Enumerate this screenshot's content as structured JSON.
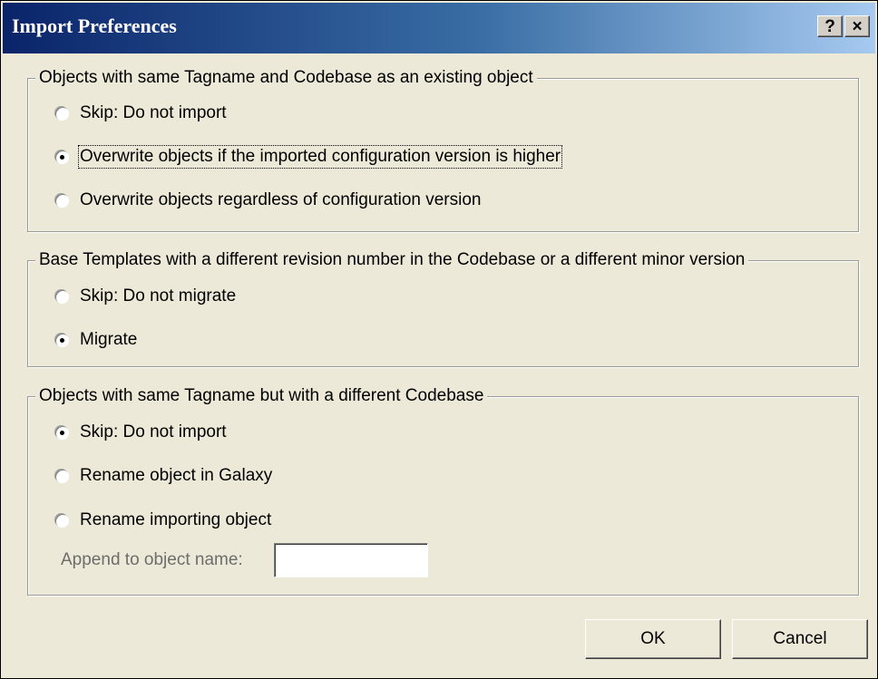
{
  "window": {
    "title": "Import Preferences",
    "help_label": "?",
    "close_label": "×"
  },
  "groups": [
    {
      "legend": "Objects with same Tagname and Codebase as an existing object",
      "options": [
        {
          "label": "Skip: Do not import",
          "selected": false
        },
        {
          "label": "Overwrite objects if the imported configuration version is higher",
          "selected": true
        },
        {
          "label": "Overwrite objects regardless of configuration version",
          "selected": false
        }
      ]
    },
    {
      "legend": "Base Templates with a different revision number in the Codebase or a different minor version",
      "options": [
        {
          "label": "Skip: Do not migrate",
          "selected": false
        },
        {
          "label": "Migrate",
          "selected": true
        }
      ]
    },
    {
      "legend": "Objects with same Tagname but with a different Codebase",
      "options": [
        {
          "label": "Skip: Do not import",
          "selected": true
        },
        {
          "label": "Rename object in Galaxy",
          "selected": false
        },
        {
          "label": "Rename importing object",
          "selected": false
        }
      ],
      "append_label": "Append to object name:",
      "append_value": ""
    }
  ],
  "buttons": {
    "ok": "OK",
    "cancel": "Cancel"
  }
}
